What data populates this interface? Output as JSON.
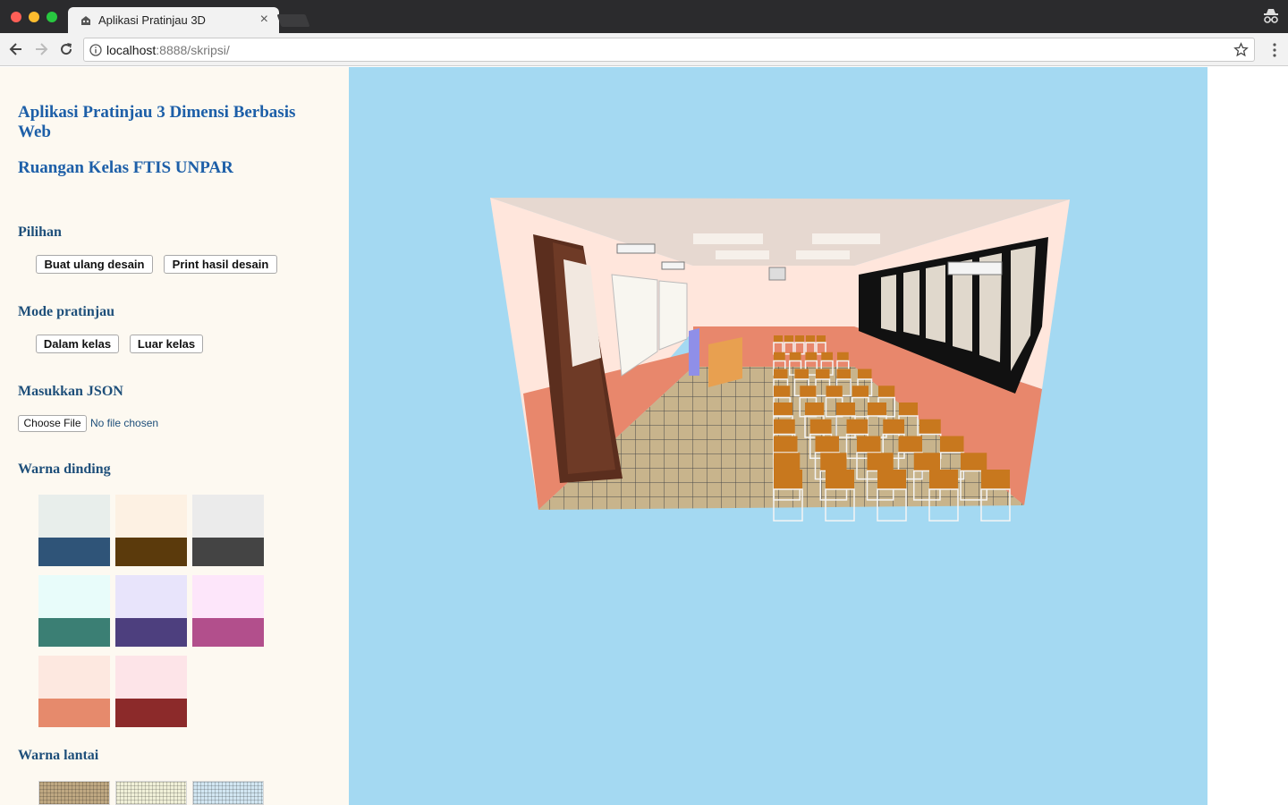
{
  "browser": {
    "tab_title": "Aplikasi Pratinjau 3D",
    "url_host": "localhost",
    "url_rest": ":8888/skripsi/"
  },
  "sidebar": {
    "title": "Aplikasi Pratinjau 3 Dimensi Berbasis Web",
    "subtitle": "Ruangan Kelas FTIS UNPAR",
    "options": {
      "heading": "Pilihan",
      "reset_label": "Buat ulang desain",
      "print_label": "Print hasil desain"
    },
    "mode": {
      "heading": "Mode pratinjau",
      "inside_label": "Dalam kelas",
      "outside_label": "Luar kelas"
    },
    "json": {
      "heading": "Masukkan JSON",
      "choose_label": "Choose File",
      "status": "No file chosen"
    },
    "wall_color": {
      "heading": "Warna dinding",
      "swatches": [
        {
          "top": "#e8eeeb",
          "bottom": "#2f5478"
        },
        {
          "top": "#fdf1e3",
          "bottom": "#5b3a0c"
        },
        {
          "top": "#ebebeb",
          "bottom": "#444444"
        },
        {
          "top": "#e8fcfa",
          "bottom": "#3b7f74"
        },
        {
          "top": "#e8e4fb",
          "bottom": "#4d3f7e"
        },
        {
          "top": "#fde6fa",
          "bottom": "#b24f8c"
        },
        {
          "top": "#fde8e0",
          "bottom": "#e68a6c"
        },
        {
          "top": "#fde4e8",
          "bottom": "#8c2a2a"
        }
      ]
    },
    "floor_color": {
      "heading": "Warna lantai",
      "swatches": [
        {
          "color": "#bfa882"
        },
        {
          "color": "#f0f0d8"
        },
        {
          "color": "#d2e6f2"
        }
      ]
    }
  },
  "scene": {
    "background": "#a4d9f2",
    "wall_upper": "#ffe6dc",
    "wall_lower": "#e8876c",
    "ceiling": "#e8d8d0",
    "floor": "#c8b48c"
  }
}
